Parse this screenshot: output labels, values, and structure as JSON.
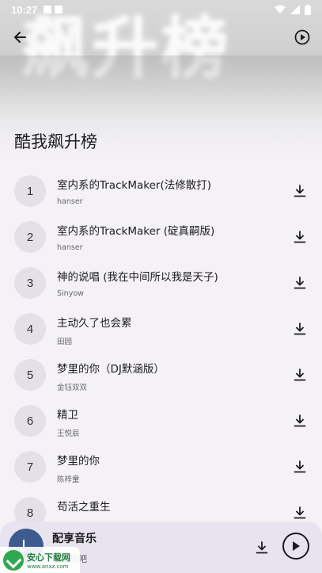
{
  "status_bar": {
    "time": "10:27"
  },
  "banner": {
    "art_text": "飙升榜"
  },
  "page": {
    "title": "酷我飙升榜"
  },
  "songs": [
    {
      "rank": "1",
      "title": "室内系的TrackMaker(法修散打)",
      "artist": "hanser"
    },
    {
      "rank": "2",
      "title": "室内系的TrackMaker (碇真嗣版)",
      "artist": "hanser"
    },
    {
      "rank": "3",
      "title": "神的说唱 (我在中间所以我是天子)",
      "artist": "Sinyow"
    },
    {
      "rank": "4",
      "title": "主动久了也会累",
      "artist": "田园"
    },
    {
      "rank": "5",
      "title": "梦里的你（DJ默涵版）",
      "artist": "金钰双双"
    },
    {
      "rank": "6",
      "title": "精卫",
      "artist": "王悦辰"
    },
    {
      "rank": "7",
      "title": "梦里的你",
      "artist": "陈梓童"
    },
    {
      "rank": "8",
      "title": "苟活之重生",
      "artist": ""
    }
  ],
  "player": {
    "title": "配享音乐",
    "subtitle": "曲播放吧"
  },
  "watermark": {
    "name": "安心下载网",
    "url": "www.anxz.com"
  },
  "icons": {
    "back": "arrow-left-icon",
    "play_top": "play-circle-icon",
    "download": "download-icon",
    "music_note": "music-note-icon"
  }
}
